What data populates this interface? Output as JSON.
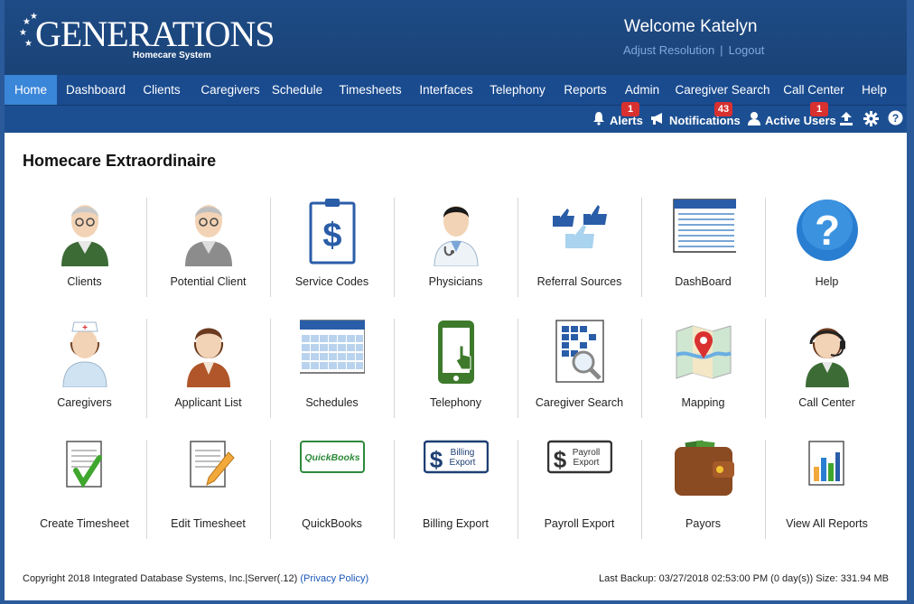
{
  "header": {
    "logo_text": "GENERATIONS",
    "logo_subtitle": "Homecare System",
    "welcome": "Welcome Katelyn",
    "adjust_resolution": "Adjust Resolution",
    "link_separator": "|",
    "logout": "Logout"
  },
  "nav": {
    "items": [
      {
        "label": "Home",
        "active": true
      },
      {
        "label": "Dashboard"
      },
      {
        "label": "Clients"
      },
      {
        "label": "Caregivers"
      },
      {
        "label": "Schedule"
      },
      {
        "label": "Timesheets"
      },
      {
        "label": "Interfaces"
      },
      {
        "label": "Telephony"
      },
      {
        "label": "Reports"
      },
      {
        "label": "Admin"
      },
      {
        "label": "Caregiver Search"
      },
      {
        "label": "Call Center"
      },
      {
        "label": "Help"
      }
    ]
  },
  "subbar": {
    "alerts": {
      "label": "Alerts",
      "count": "1",
      "icon": "bell-icon"
    },
    "notifications": {
      "label": "Notifications",
      "count": "43",
      "icon": "megaphone-icon"
    },
    "active_users": {
      "label": "Active Users",
      "count": "1",
      "icon": "user-icon"
    },
    "upload_icon": "upload-icon",
    "settings_icon": "gear-icon",
    "help_icon": "question-circle-icon"
  },
  "main": {
    "title": "Homecare Extraordinaire",
    "tiles": [
      {
        "label": "Clients",
        "icon": "elderly-man-icon"
      },
      {
        "label": "Potential Client",
        "icon": "elderly-man-gray-icon"
      },
      {
        "label": "Service Codes",
        "icon": "clipboard-dollar-icon"
      },
      {
        "label": "Physicians",
        "icon": "doctor-icon"
      },
      {
        "label": "Referral Sources",
        "icon": "thumbs-up-icon"
      },
      {
        "label": "DashBoard",
        "icon": "dashboard-grid-icon"
      },
      {
        "label": "Help",
        "icon": "help-icon"
      },
      {
        "label": "Caregivers",
        "icon": "nurse-icon"
      },
      {
        "label": "Applicant List",
        "icon": "applicant-icon"
      },
      {
        "label": "Schedules",
        "icon": "calendar-icon"
      },
      {
        "label": "Telephony",
        "icon": "phone-touch-icon"
      },
      {
        "label": "Caregiver Search",
        "icon": "document-search-icon"
      },
      {
        "label": "Mapping",
        "icon": "map-pin-icon"
      },
      {
        "label": "Call Center",
        "icon": "headset-operator-icon"
      },
      {
        "label": "Create Timesheet",
        "icon": "checked-document-icon"
      },
      {
        "label": "Edit Timesheet",
        "icon": "pencil-document-icon"
      },
      {
        "label": "QuickBooks",
        "icon": "quickbooks-icon",
        "badge_text": "QuickBooks"
      },
      {
        "label": "Billing Export",
        "icon": "billing-export-icon",
        "badge_line1": "Billing",
        "badge_line2": "Export"
      },
      {
        "label": "Payroll Export",
        "icon": "payroll-export-icon",
        "badge_line1": "Payroll",
        "badge_line2": "Export"
      },
      {
        "label": "Payors",
        "icon": "wallet-icon"
      },
      {
        "label": "View All Reports",
        "icon": "bar-chart-report-icon"
      }
    ]
  },
  "footer": {
    "copyright": "Copyright 2018 Integrated Database Systems, Inc.|Server(.12)",
    "privacy": "(Privacy Policy)",
    "backup": "Last Backup: 03/27/2018 02:53:00 PM (0 day(s)) Size: 331.94 MB"
  },
  "colors": {
    "header_bg": "#1e4b86",
    "nav_bg": "#1a4b8f",
    "nav_active": "#3a86d9",
    "badge_red": "#d93030",
    "link_blue": "#7ea9e0"
  }
}
